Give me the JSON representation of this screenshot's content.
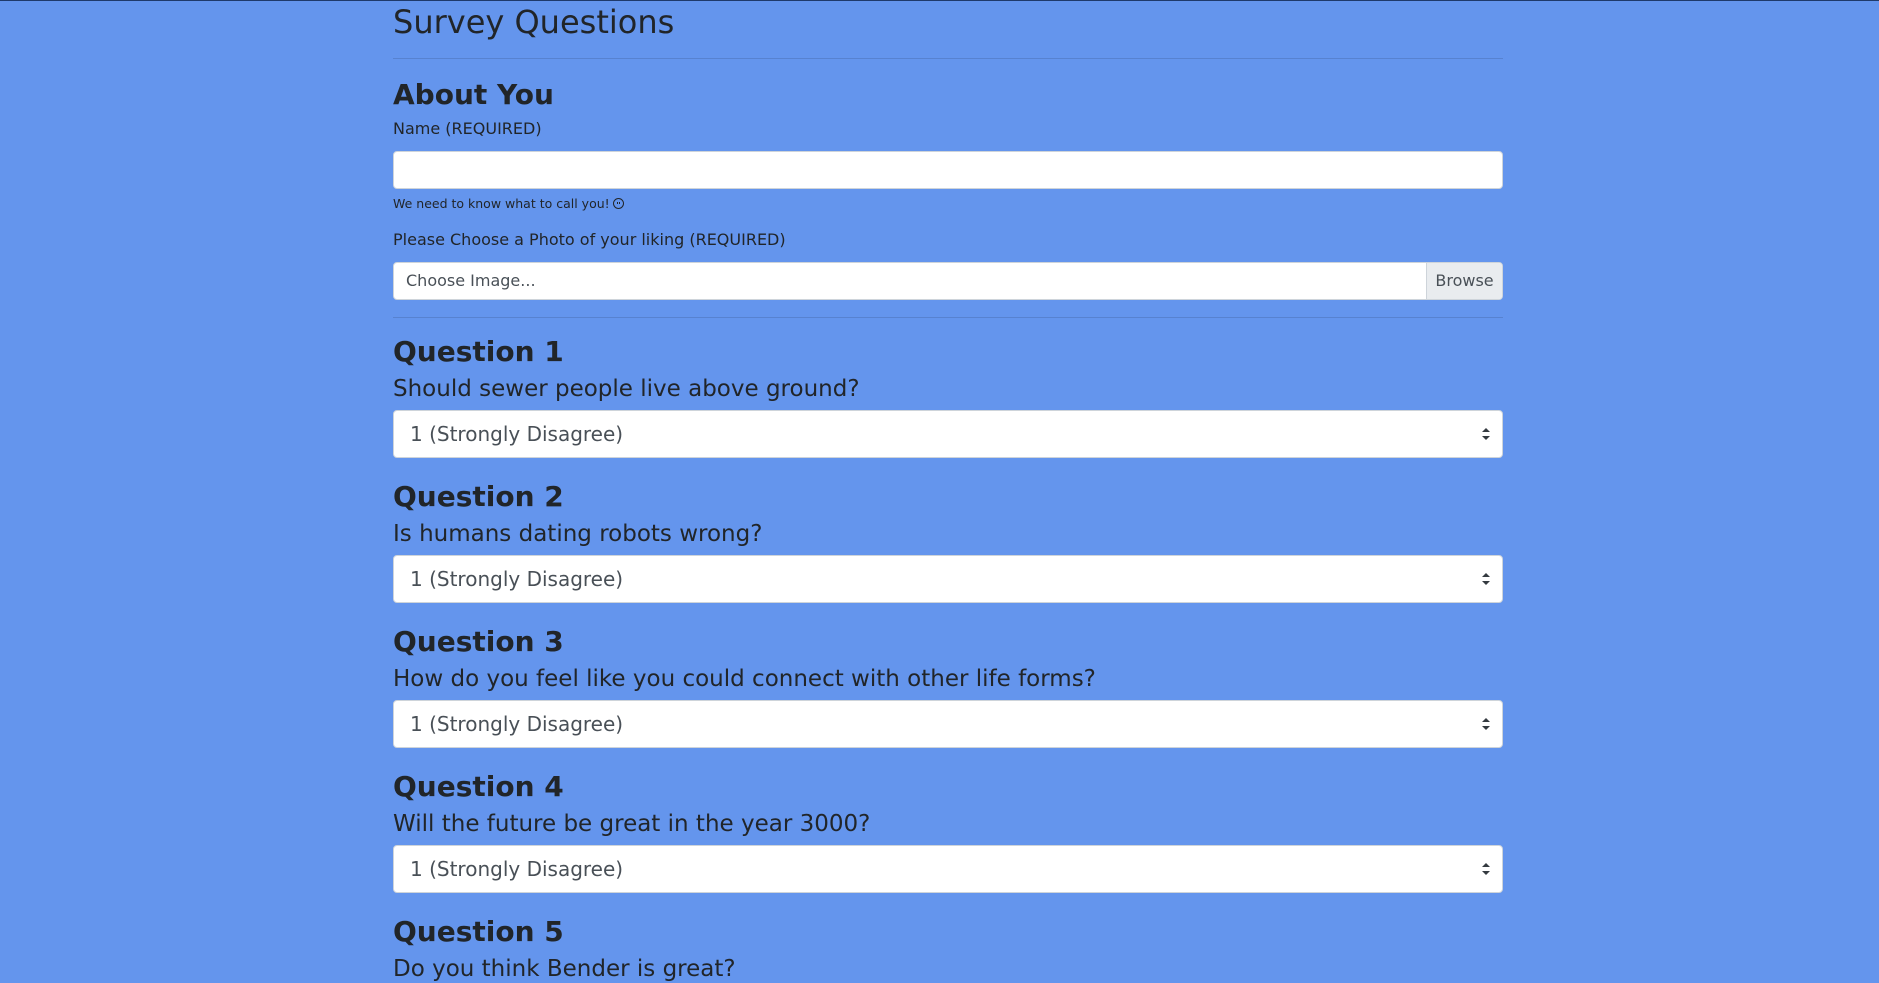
{
  "page_title": "Survey Questions",
  "about": {
    "heading": "About You",
    "name_label": "Name (REQUIRED)",
    "name_value": "",
    "name_help": "We need to know what to call you!",
    "photo_label": "Please Choose a Photo of your liking (REQUIRED)",
    "photo_placeholder": "Choose Image...",
    "browse_label": "Browse"
  },
  "questions": [
    {
      "title": "Question 1",
      "text": "Should sewer people live above ground?",
      "selected": "1 (Strongly Disagree)"
    },
    {
      "title": "Question 2",
      "text": "Is humans dating robots wrong?",
      "selected": "1 (Strongly Disagree)"
    },
    {
      "title": "Question 3",
      "text": "How do you feel like you could connect with other life forms?",
      "selected": "1 (Strongly Disagree)"
    },
    {
      "title": "Question 4",
      "text": "Will the future be great in the year 3000?",
      "selected": "1 (Strongly Disagree)"
    },
    {
      "title": "Question 5",
      "text": "Do you think Bender is great?"
    }
  ],
  "colors": {
    "background": "#6495ed",
    "text": "#212529"
  }
}
